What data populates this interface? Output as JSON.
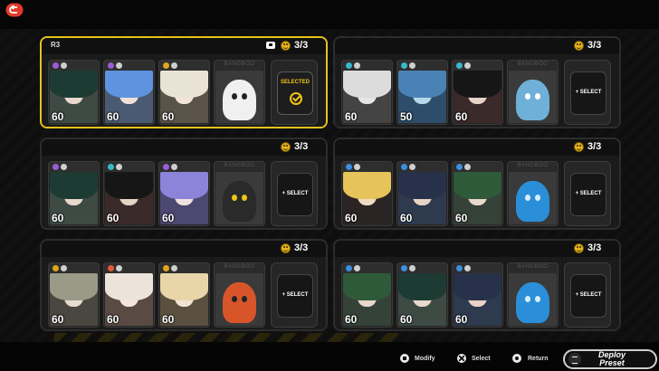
{
  "colors": {
    "accent": "#e8c21c",
    "selected_label": "#f0c419"
  },
  "presets": [
    {
      "tag": "R3",
      "count": "3/3",
      "selected": true,
      "agents": [
        {
          "level": "60",
          "hair": "#1d3b33",
          "skin": "#e9d8cc",
          "bg": "#3e4a44",
          "icons": [
            "#9a5cd6",
            "#cfcfcf"
          ]
        },
        {
          "level": "60",
          "hair": "#5e93e0",
          "skin": "#f1e1d8",
          "bg": "#4a5a72",
          "icons": [
            "#9a5cd6",
            "#cfcfcf"
          ]
        },
        {
          "level": "60",
          "hair": "#e9e3d6",
          "skin": "#f2e4d8",
          "bg": "#5a5348",
          "icons": [
            "#e0a51c",
            "#cfcfcf"
          ]
        }
      ],
      "bangboo": {
        "label": "BANGBOO",
        "color": "#f0f0f0",
        "accent": "#222"
      },
      "action": {
        "label": "SELECTED",
        "check": true
      }
    },
    {
      "tag": "",
      "count": "3/3",
      "selected": false,
      "agents": [
        {
          "level": "60",
          "hair": "#dcdcdc",
          "skin": "#e6e6e6",
          "bg": "#444",
          "icons": [
            "#38b8c8",
            "#cfcfcf"
          ]
        },
        {
          "level": "50",
          "hair": "#4b82b5",
          "skin": "#b7d7ea",
          "bg": "#2e4d6b",
          "icons": [
            "#38b8c8",
            "#cfcfcf"
          ]
        },
        {
          "level": "60",
          "hair": "#161616",
          "skin": "#e6d4c7",
          "bg": "#3b2a2a",
          "icons": [
            "#38b8c8",
            "#cfcfcf"
          ]
        }
      ],
      "bangboo": {
        "label": "BANGBOO",
        "color": "#6fb0d8",
        "accent": "#fff"
      },
      "action": {
        "label": "+ SELECT",
        "check": false
      }
    },
    {
      "tag": "",
      "count": "3/3",
      "selected": false,
      "agents": [
        {
          "level": "60",
          "hair": "#1d3b33",
          "skin": "#e9d8cc",
          "bg": "#3e4a44",
          "icons": [
            "#9a5cd6",
            "#cfcfcf"
          ]
        },
        {
          "level": "60",
          "hair": "#161616",
          "skin": "#e6d4c7",
          "bg": "#3b2a2a",
          "icons": [
            "#38b8c8",
            "#cfcfcf"
          ]
        },
        {
          "level": "60",
          "hair": "#8c84d8",
          "skin": "#efe2de",
          "bg": "#4d4870",
          "icons": [
            "#9a5cd6",
            "#cfcfcf"
          ]
        }
      ],
      "bangboo": {
        "label": "BANGBOO",
        "color": "#2a2a2a",
        "accent": "#f0c419"
      },
      "action": {
        "label": "+ SELECT",
        "check": false
      }
    },
    {
      "tag": "",
      "count": "3/3",
      "selected": false,
      "agents": [
        {
          "level": "60",
          "hair": "#e6c45a",
          "skin": "#f0dcc2",
          "bg": "#2b2424",
          "icons": [
            "#3a8fe0",
            "#cfcfcf"
          ]
        },
        {
          "level": "60",
          "hair": "#27324a",
          "skin": "#e8d4c6",
          "bg": "#2e3a4e",
          "icons": [
            "#3a8fe0",
            "#cfcfcf"
          ]
        },
        {
          "level": "60",
          "hair": "#2f5a3a",
          "skin": "#e9d8cc",
          "bg": "#354238",
          "icons": [
            "#3a8fe0",
            "#cfcfcf"
          ]
        }
      ],
      "bangboo": {
        "label": "BANGBOO",
        "color": "#2a8fd8",
        "accent": "#d8eefa"
      },
      "action": {
        "label": "+ SELECT",
        "check": false
      }
    },
    {
      "tag": "",
      "count": "3/3",
      "selected": false,
      "agents": [
        {
          "level": "60",
          "hair": "#9a9a88",
          "skin": "#e8dcd0",
          "bg": "#4a4640",
          "icons": [
            "#e0a51c",
            "#cfcfcf"
          ]
        },
        {
          "level": "60",
          "hair": "#ece4da",
          "skin": "#f4e4da",
          "bg": "#5a4a44",
          "icons": [
            "#e05a3a",
            "#cfcfcf"
          ]
        },
        {
          "level": "60",
          "hair": "#e8d6a8",
          "skin": "#f2e2d2",
          "bg": "#5a5040",
          "icons": [
            "#e0a51c",
            "#cfcfcf"
          ]
        }
      ],
      "bangboo": {
        "label": "BANGBOO",
        "color": "#d8552a",
        "accent": "#222"
      },
      "action": {
        "label": "+ SELECT",
        "check": false
      }
    },
    {
      "tag": "",
      "count": "3/3",
      "selected": false,
      "agents": [
        {
          "level": "60",
          "hair": "#2f5a3a",
          "skin": "#e9d8cc",
          "bg": "#354238",
          "icons": [
            "#3a8fe0",
            "#cfcfcf"
          ]
        },
        {
          "level": "60",
          "hair": "#1d3b33",
          "skin": "#e9d8cc",
          "bg": "#3e4a44",
          "icons": [
            "#3a8fe0",
            "#cfcfcf"
          ]
        },
        {
          "level": "60",
          "hair": "#27324a",
          "skin": "#e8d4c6",
          "bg": "#2e3a4e",
          "icons": [
            "#3a8fe0",
            "#cfcfcf"
          ]
        }
      ],
      "bangboo": {
        "label": "BANGBOO",
        "color": "#2a8fd8",
        "accent": "#d8eefa"
      },
      "action": {
        "label": "+ SELECT",
        "check": false
      }
    }
  ],
  "footer": {
    "modify": "Modify",
    "select": "Select",
    "return": "Return",
    "deploy": "Deploy Preset"
  },
  "icons": {
    "back": "return-arrow-icon",
    "preset_chip": "camera-icon",
    "team_rating": "smiley-icon",
    "deploy": "menu-icon"
  }
}
